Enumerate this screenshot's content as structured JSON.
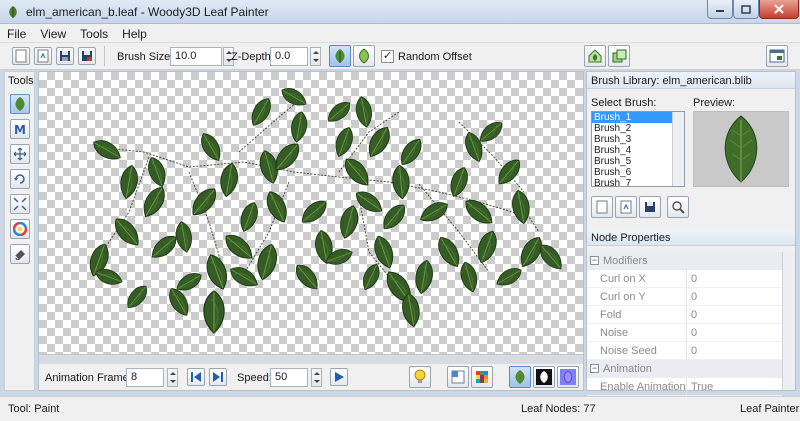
{
  "window": {
    "title": "elm_american_b.leaf - Woody3D Leaf Painter"
  },
  "menu": [
    {
      "label": "File"
    },
    {
      "label": "View"
    },
    {
      "label": "Tools"
    },
    {
      "label": "Help"
    }
  ],
  "toolbar": {
    "brush_size_label": "Brush Size:",
    "brush_size_value": "10.0",
    "z_depth_label": "Z-Depth:",
    "z_depth_value": "0.0",
    "random_offset_label": "Random Offset",
    "random_offset_checked": true
  },
  "tools": {
    "title": "Tools"
  },
  "animation": {
    "frames_label": "Animation Frames:",
    "frames_value": "8",
    "speed_label": "Speed:",
    "speed_value": "50"
  },
  "brush_library": {
    "header": "Brush Library: elm_american.blib",
    "select_label": "Select Brush:",
    "preview_label": "Preview:",
    "brushes": [
      "Brush_1",
      "Brush_2",
      "Brush_3",
      "Brush_4",
      "Brush_5",
      "Brush_6",
      "Brush_7"
    ],
    "selected_index": 0
  },
  "node_properties": {
    "header": "Node Properties",
    "categories": [
      {
        "name": "Modifiers",
        "rows": [
          {
            "name": "Curl on X",
            "value": "0"
          },
          {
            "name": "Curl on Y",
            "value": "0"
          },
          {
            "name": "Fold",
            "value": "0"
          },
          {
            "name": "Noise",
            "value": "0"
          },
          {
            "name": "Noise Seed",
            "value": "0"
          }
        ]
      },
      {
        "name": "Animation",
        "rows": [
          {
            "name": "Enable Animation",
            "value": "True"
          }
        ]
      }
    ]
  },
  "status": {
    "tool": "Tool: Paint",
    "leaf_nodes": "Leaf Nodes: 77",
    "app": "Leaf Painter"
  },
  "colors": {
    "leaf_dark": "#2f4f22",
    "leaf_mid": "#3e6b2a",
    "leaf_light": "#6f9a4a",
    "selection": "#3399ff"
  }
}
